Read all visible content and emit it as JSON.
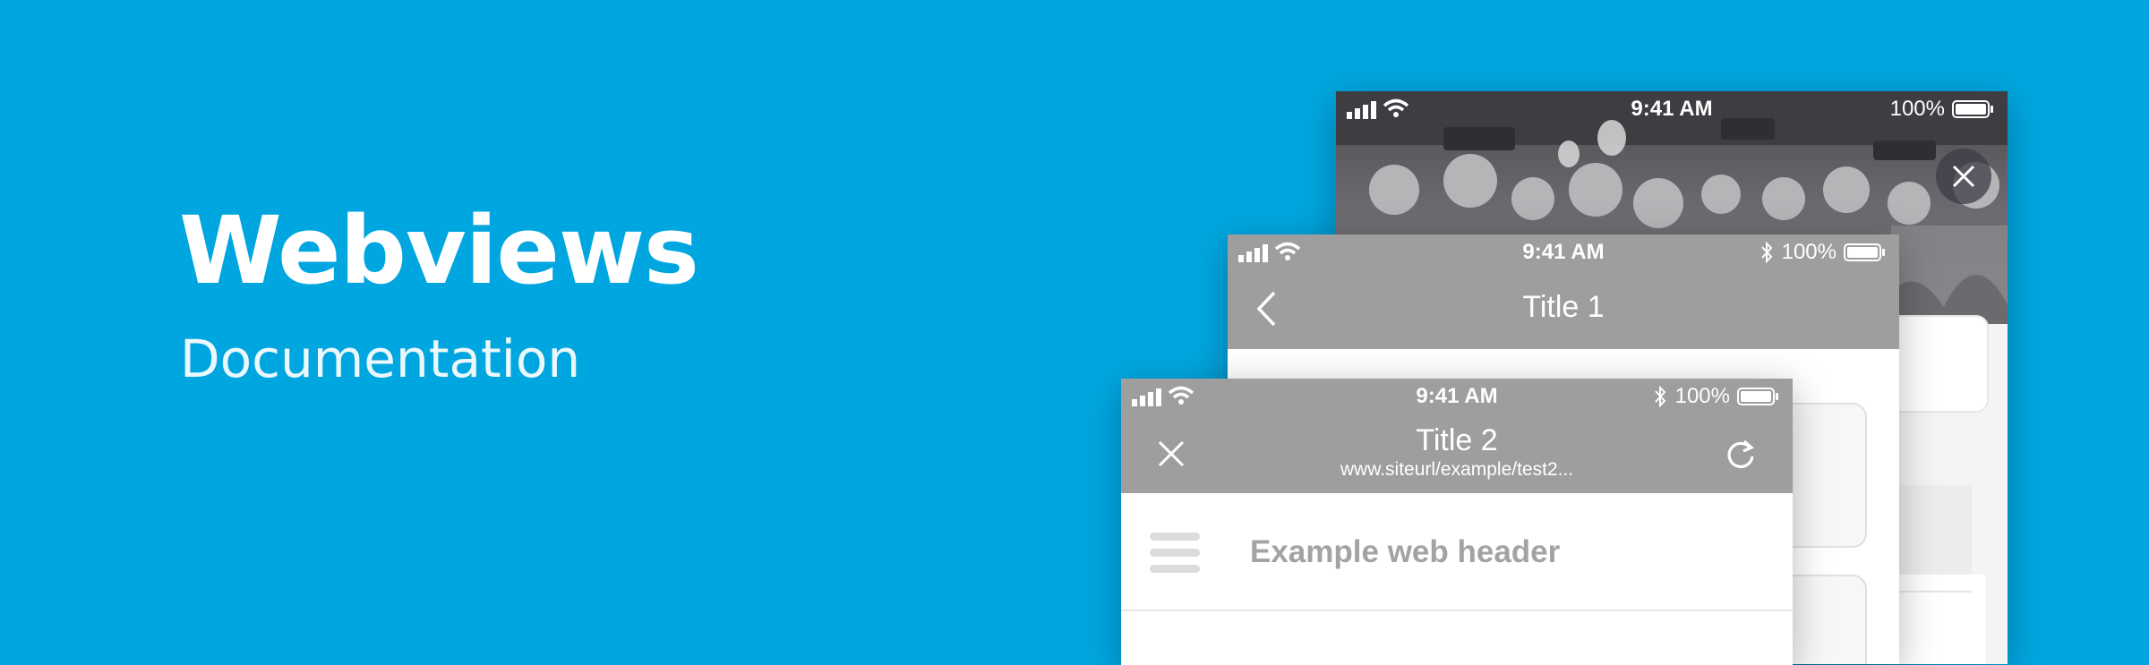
{
  "hero": {
    "title": "Webviews",
    "subtitle": "Documentation"
  },
  "colors": {
    "background": "#00a6e0",
    "nav_bar": "#9e9e9e",
    "header_text": "#a3a3a3"
  },
  "phone_back": {
    "status": {
      "time": "9:41 AM",
      "battery": "100%"
    },
    "icons": [
      "signal-icon",
      "wifi-icon",
      "battery-icon",
      "close-icon"
    ]
  },
  "phone_mid": {
    "status": {
      "time": "9:41 AM",
      "battery": "100%"
    },
    "nav": {
      "title": "Title 1"
    },
    "icons": [
      "signal-icon",
      "wifi-icon",
      "bluetooth-icon",
      "battery-icon",
      "back-chevron-icon"
    ]
  },
  "phone_front": {
    "status": {
      "time": "9:41 AM",
      "battery": "100%"
    },
    "nav": {
      "title": "Title 2",
      "url": "www.siteurl/example/test2..."
    },
    "web_header": {
      "text": "Example web header"
    },
    "icons": [
      "signal-icon",
      "wifi-icon",
      "bluetooth-icon",
      "battery-icon",
      "close-icon",
      "refresh-icon",
      "hamburger-icon"
    ]
  }
}
